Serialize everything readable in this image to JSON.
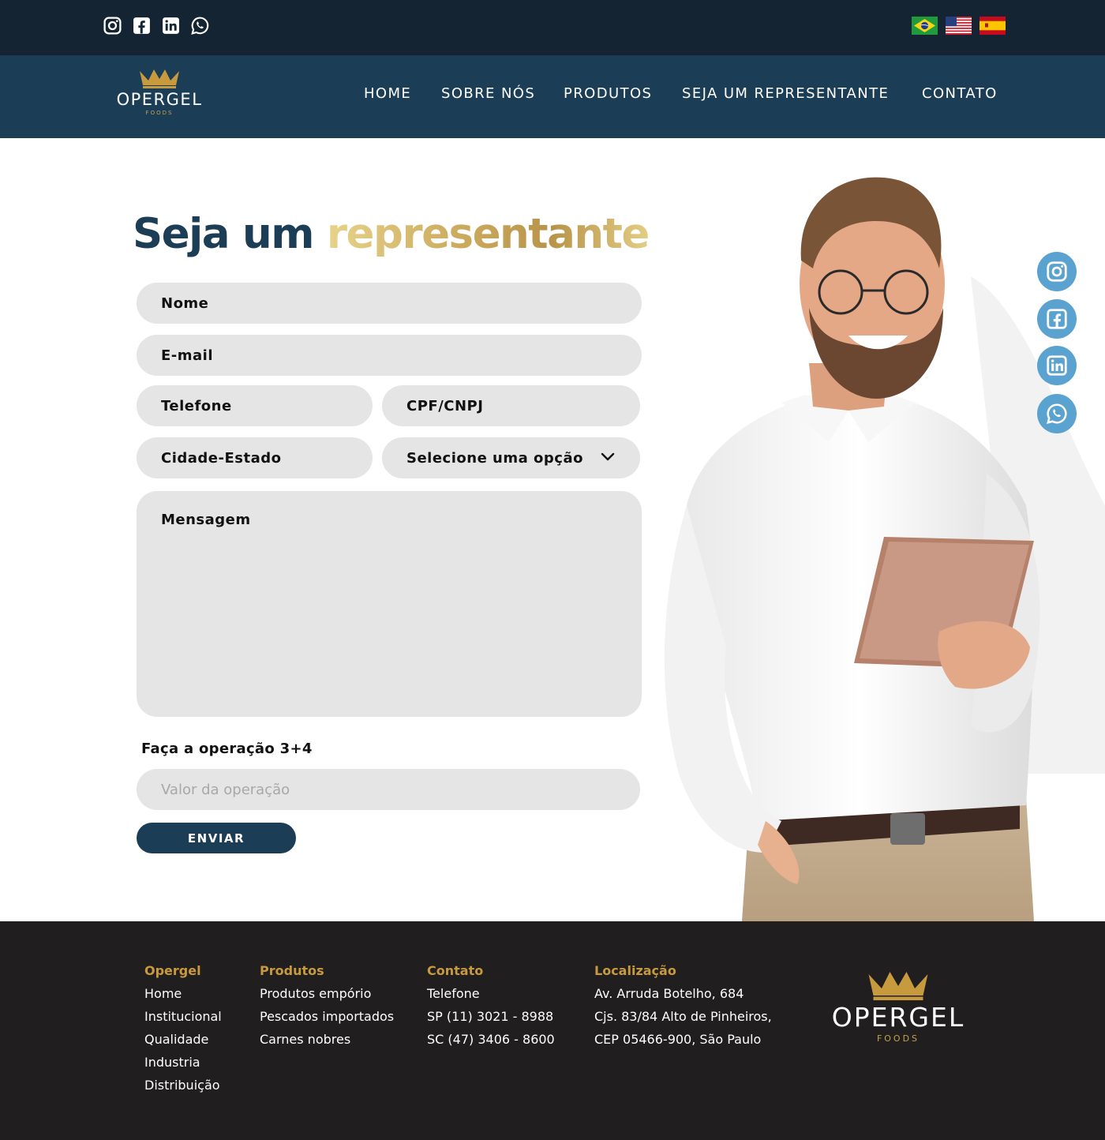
{
  "top_social_icons": [
    "instagram-icon",
    "facebook-icon",
    "linkedin-icon",
    "whatsapp-icon"
  ],
  "flags": [
    "brazil-flag",
    "usa-flag",
    "spain-flag"
  ],
  "logo": {
    "brand": "OPERGEL",
    "sub": "FOODS"
  },
  "nav": {
    "items": [
      "HOME",
      "SOBRE NÓS",
      "PRODUTOS",
      "SEJA UM REPRESENTANTE",
      "CONTATO"
    ]
  },
  "hero": {
    "title_part1": "Seja um",
    "title_part2": "representante"
  },
  "form": {
    "nome": "Nome",
    "email": "E-mail",
    "telefone": "Telefone",
    "cpf": "CPF/CNPJ",
    "cidade": "Cidade-Estado",
    "select": "Selecione uma opção",
    "mensagem": "Mensagem",
    "op_label": "Faça a operação 3+4",
    "op_placeholder": "Valor da operação",
    "submit": "ENVIAR"
  },
  "colors": {
    "navy": "#1c3d56",
    "topbar": "#142433",
    "gold": "#c89a3e",
    "social_float": "#5aa2cf",
    "footer": "#211e1f"
  },
  "footer": {
    "col1": {
      "heading": "Opergel",
      "items": [
        "Home",
        "Institucional",
        "Qualidade",
        "Industria",
        "Distribuição"
      ]
    },
    "col2": {
      "heading": "Produtos",
      "items": [
        "Produtos empório",
        "Pescados importados",
        "Carnes nobres"
      ]
    },
    "col3": {
      "heading": "Contato",
      "items": [
        "Telefone",
        "SP (11) 3021 - 8988",
        "SC (47) 3406 - 8600"
      ]
    },
    "col4": {
      "heading": "Localização",
      "items": [
        "Av. Arruda Botelho, 684",
        "Cjs. 83/84 Alto de Pinheiros,",
        "CEP 05466-900, São Paulo"
      ]
    },
    "logo": {
      "brand": "OPERGEL",
      "sub": "FOODS"
    }
  }
}
